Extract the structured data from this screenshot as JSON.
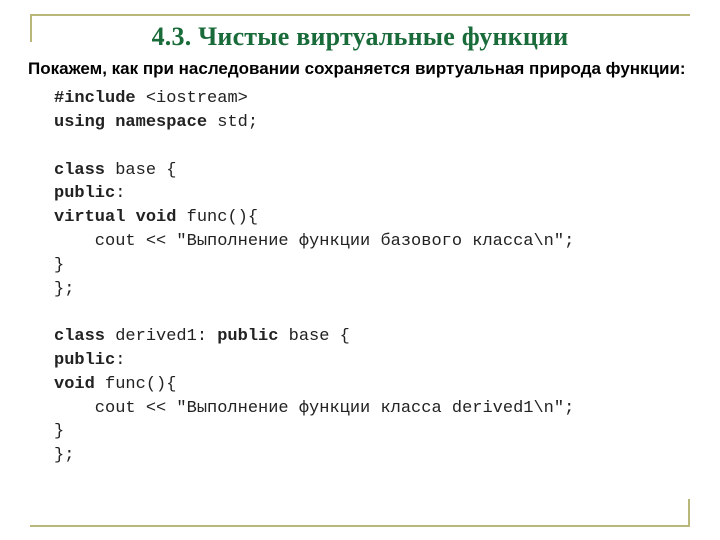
{
  "title": "4.3. Чистые виртуальные функции",
  "intro": "Покажем, как при наследовании сохраняется виртуальная природа функции:",
  "code": {
    "l1a": "#include",
    "l1b": " <iostream>",
    "l2a": "using",
    "l2b": " ",
    "l2c": "namespace",
    "l2d": " std;",
    "l3": "",
    "l4a": "class",
    "l4b": " base {",
    "l5a": "public",
    "l5b": ":",
    "l6a": "virtual",
    "l6b": " ",
    "l6c": "void",
    "l6d": " func(){",
    "l7": "    cout << \"Выполнение функции базового класса\\n\";",
    "l8": "}",
    "l9": "};",
    "l10": "",
    "l11a": "class",
    "l11b": " derived1: ",
    "l11c": "public",
    "l11d": " base {",
    "l12a": "public",
    "l12b": ":",
    "l13a": "void",
    "l13b": " func(){",
    "l14": "    cout << \"Выполнение функции класса derived1\\n\";",
    "l15": "}",
    "l16": "};"
  }
}
